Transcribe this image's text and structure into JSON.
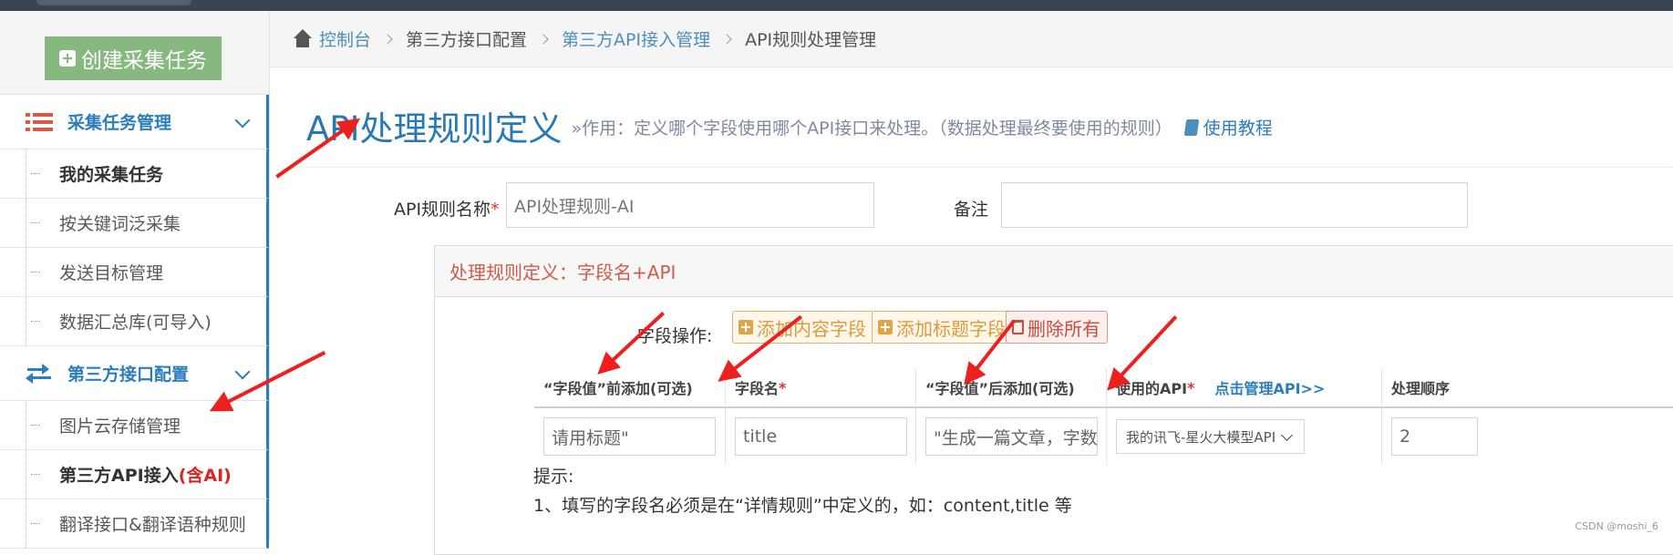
{
  "sidebar": {
    "create_label": "创建采集任务",
    "groups": [
      {
        "label": "采集任务管理",
        "items": [
          "我的采集任务",
          "按关键词泛采集",
          "发送目标管理",
          "数据汇总库(可导入)"
        ]
      },
      {
        "label": "第三方接口配置",
        "items": [
          "图片云存储管理",
          "第三方API接入",
          "翻译接口&翻译语种规则"
        ]
      }
    ],
    "ai_suffix": "(含AI)"
  },
  "breadcrumb": [
    "控制台",
    "第三方接口配置",
    "第三方API接入管理",
    "API规则处理管理"
  ],
  "header": {
    "title": "API处理规则定义",
    "subtitle": "»作用：定义哪个字段使用哪个API接口来处理。（数据处理最终要使用的规则）",
    "tutorial": "使用教程"
  },
  "form": {
    "name_label": "API规则名称",
    "name_value": "API处理规则-AI",
    "remark_label": "备注",
    "remark_value": ""
  },
  "rule_box": {
    "title": "处理规则定义：字段名+API",
    "ops_label": "字段操作:",
    "buttons": [
      "添加内容字段",
      "添加标题字段",
      "删除所有"
    ],
    "columns": [
      "“字段值”前添加(可选)",
      "字段名",
      "“字段值”后添加(可选)",
      "使用的API",
      "点击管理API>>",
      "处理顺序"
    ],
    "row": {
      "prefix": "请用标题\"",
      "field": "title",
      "suffix": "\"生成一篇文章，字数不",
      "api": "我的讯飞-星火大模型API",
      "order": "2"
    },
    "hint_label": "提示:",
    "hint_line": "1、填写的字段名必须是在“详情规则”中定义的，如：content,title 等"
  },
  "watermark": "CSDN @moshi_6",
  "colors": {
    "accent": "#2b7dbc",
    "create_button": "#87b87f",
    "title_red": "#d15b47",
    "arrow": "#ee1f1f"
  }
}
